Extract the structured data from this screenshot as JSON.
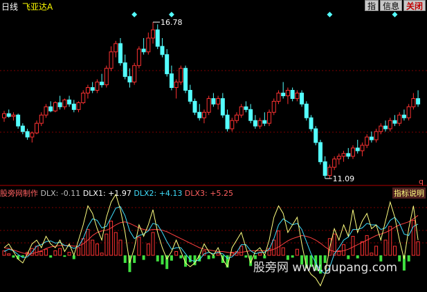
{
  "header": {
    "period": "日线",
    "stock_name": "飞亚达A",
    "buttons": [
      "指",
      "信息",
      "关闭"
    ]
  },
  "price_labels": {
    "high": "16.78",
    "low": "11.09"
  },
  "q_marker": "q",
  "indicator": {
    "name": "股旁网制作",
    "dlx": "DLX: -0.11",
    "dlx1": "DLX1: +1.97",
    "dlx2": "DLX2: +4.13",
    "dlx3": "DLX3: +5.25",
    "help": "指标说明"
  },
  "watermark": "股旁网 www.gupang.com",
  "colors": {
    "up": "#ff3232",
    "down": "#54ffff",
    "grid": "#800000",
    "dlx1": "#ffff80",
    "dlx2": "#40e0ff",
    "dlx3": "#ff4040"
  },
  "chart_data": {
    "type": "candlestick",
    "high_price": 16.78,
    "low_price": 11.09,
    "candles": [
      [
        13.3,
        13.55,
        13.15,
        13.45
      ],
      [
        13.45,
        13.6,
        13.3,
        13.35
      ],
      [
        13.35,
        13.5,
        13.2,
        13.4
      ],
      [
        13.4,
        13.45,
        12.9,
        13.0
      ],
      [
        13.0,
        13.1,
        12.7,
        12.8
      ],
      [
        12.8,
        12.9,
        12.5,
        12.6
      ],
      [
        12.6,
        12.8,
        12.4,
        12.75
      ],
      [
        12.75,
        13.2,
        12.7,
        13.1
      ],
      [
        13.1,
        13.5,
        13.0,
        13.4
      ],
      [
        13.4,
        13.8,
        13.3,
        13.7
      ],
      [
        13.7,
        13.9,
        13.5,
        13.55
      ],
      [
        13.55,
        13.9,
        13.5,
        13.85
      ],
      [
        13.85,
        14.1,
        13.6,
        13.7
      ],
      [
        13.7,
        14.0,
        13.6,
        13.95
      ],
      [
        13.95,
        14.1,
        13.7,
        13.8
      ],
      [
        13.8,
        13.95,
        13.5,
        13.6
      ],
      [
        13.6,
        13.9,
        13.5,
        13.85
      ],
      [
        13.85,
        14.3,
        13.8,
        14.2
      ],
      [
        14.2,
        14.5,
        14.0,
        14.4
      ],
      [
        14.4,
        14.6,
        14.2,
        14.3
      ],
      [
        14.3,
        14.7,
        14.2,
        14.6
      ],
      [
        14.6,
        14.9,
        14.4,
        14.5
      ],
      [
        14.5,
        15.2,
        14.4,
        15.1
      ],
      [
        15.1,
        15.9,
        15.0,
        15.7
      ],
      [
        15.7,
        16.1,
        15.5,
        16.0
      ],
      [
        16.0,
        16.2,
        15.2,
        15.3
      ],
      [
        15.3,
        15.6,
        14.7,
        14.8
      ],
      [
        14.8,
        15.1,
        14.4,
        14.6
      ],
      [
        14.6,
        15.3,
        14.5,
        15.2
      ],
      [
        15.2,
        15.9,
        15.1,
        15.8
      ],
      [
        15.8,
        16.2,
        15.6,
        15.7
      ],
      [
        15.7,
        16.4,
        15.6,
        16.2
      ],
      [
        16.2,
        16.78,
        16.0,
        16.5
      ],
      [
        16.5,
        16.7,
        15.8,
        15.9
      ],
      [
        15.9,
        16.2,
        15.5,
        15.6
      ],
      [
        15.6,
        15.8,
        14.8,
        14.9
      ],
      [
        14.9,
        15.2,
        14.3,
        14.4
      ],
      [
        14.4,
        14.7,
        14.0,
        14.6
      ],
      [
        14.6,
        15.2,
        14.5,
        15.1
      ],
      [
        15.1,
        15.2,
        14.2,
        14.3
      ],
      [
        14.3,
        14.5,
        13.8,
        13.9
      ],
      [
        13.9,
        14.0,
        13.4,
        13.5
      ],
      [
        13.5,
        13.8,
        13.2,
        13.3
      ],
      [
        13.3,
        13.6,
        13.1,
        13.5
      ],
      [
        13.5,
        14.1,
        13.4,
        14.0
      ],
      [
        14.0,
        14.2,
        13.7,
        13.8
      ],
      [
        13.8,
        14.1,
        13.6,
        14.0
      ],
      [
        14.0,
        14.2,
        13.3,
        13.4
      ],
      [
        13.4,
        13.6,
        12.8,
        12.9
      ],
      [
        12.9,
        13.3,
        12.8,
        13.2
      ],
      [
        13.2,
        13.5,
        13.1,
        13.4
      ],
      [
        13.4,
        13.8,
        13.3,
        13.7
      ],
      [
        13.7,
        13.9,
        13.5,
        13.6
      ],
      [
        13.6,
        13.8,
        13.1,
        13.2
      ],
      [
        13.2,
        13.4,
        12.9,
        13.0
      ],
      [
        13.0,
        13.3,
        12.9,
        13.2
      ],
      [
        13.2,
        13.5,
        13.0,
        13.1
      ],
      [
        13.1,
        13.6,
        13.0,
        13.5
      ],
      [
        13.5,
        14.0,
        13.4,
        13.9
      ],
      [
        13.9,
        14.3,
        13.8,
        14.2
      ],
      [
        14.2,
        14.6,
        14.0,
        14.1
      ],
      [
        14.1,
        14.4,
        13.8,
        14.3
      ],
      [
        14.3,
        14.4,
        13.9,
        14.0
      ],
      [
        14.0,
        14.3,
        13.9,
        14.2
      ],
      [
        14.2,
        14.3,
        13.7,
        13.8
      ],
      [
        13.8,
        13.9,
        13.2,
        13.3
      ],
      [
        13.3,
        13.4,
        12.8,
        12.9
      ],
      [
        12.9,
        13.0,
        12.3,
        12.4
      ],
      [
        12.4,
        12.5,
        11.6,
        11.7
      ],
      [
        11.7,
        11.9,
        11.09,
        11.2
      ],
      [
        11.2,
        11.6,
        11.1,
        11.5
      ],
      [
        11.5,
        11.9,
        11.4,
        11.8
      ],
      [
        11.8,
        12.0,
        11.6,
        11.9
      ],
      [
        11.9,
        12.1,
        11.7,
        12.0
      ],
      [
        12.0,
        12.2,
        11.8,
        11.9
      ],
      [
        11.9,
        12.3,
        11.8,
        12.2
      ],
      [
        12.2,
        12.5,
        12.0,
        12.1
      ],
      [
        12.1,
        12.4,
        11.9,
        12.3
      ],
      [
        12.3,
        12.7,
        12.2,
        12.6
      ],
      [
        12.6,
        12.8,
        12.4,
        12.5
      ],
      [
        12.5,
        12.9,
        12.4,
        12.8
      ],
      [
        12.8,
        13.1,
        12.7,
        13.0
      ],
      [
        13.0,
        13.2,
        12.8,
        12.9
      ],
      [
        12.9,
        13.3,
        12.8,
        13.2
      ],
      [
        13.2,
        13.4,
        13.0,
        13.1
      ],
      [
        13.1,
        13.5,
        13.0,
        13.4
      ],
      [
        13.4,
        13.6,
        13.2,
        13.3
      ],
      [
        13.3,
        13.8,
        13.2,
        13.7
      ],
      [
        13.7,
        14.2,
        13.6,
        14.0
      ],
      [
        14.0,
        14.3,
        13.7,
        13.8
      ]
    ],
    "dlx_bars": [
      0.6,
      0.2,
      -0.3,
      -0.5,
      -0.2,
      0.4,
      0.9,
      1.2,
      0.5,
      0.8,
      -0.3,
      0.6,
      0.9,
      -0.2,
      0.4,
      -0.5,
      1.0,
      2.2,
      3.4,
      2.0,
      1.5,
      0.3,
      2.8,
      4.5,
      3.0,
      2.0,
      -1.0,
      -2.2,
      -1.0,
      2.4,
      -0.6,
      1.5,
      3.0,
      -0.8,
      -1.2,
      -1.8,
      -0.7,
      0.5,
      -0.4,
      -1.5,
      -0.9,
      -1.3,
      -0.8,
      0.6,
      -0.5,
      -0.4,
      0.3,
      -1.0,
      -1.6,
      0.4,
      0.5,
      1.2,
      -0.3,
      -1.4,
      -0.5,
      0.3,
      -0.4,
      0.9,
      2.0,
      3.2,
      1.0,
      -0.6,
      -0.3,
      0.8,
      -1.2,
      -1.7,
      -1.5,
      -2.0,
      -2.4,
      -1.0,
      2.2,
      2.8,
      0.6,
      1.4,
      -0.5,
      2.5,
      -0.4,
      1.8,
      2.6,
      0.3,
      1.2,
      -0.8,
      2.0,
      3.8,
      1.2,
      -0.8,
      -2.0,
      -0.8,
      4.6,
      1.8
    ],
    "dlx1": [
      1.0,
      1.5,
      0.5,
      -0.5,
      -1.0,
      0.2,
      1.5,
      2.0,
      1.0,
      2.5,
      1.5,
      1.0,
      2.0,
      0.5,
      1.5,
      0.0,
      2.0,
      4.0,
      6.5,
      5.5,
      3.5,
      2.0,
      5.0,
      7.0,
      8.0,
      6.0,
      3.0,
      -1.0,
      1.0,
      4.0,
      2.5,
      4.0,
      6.0,
      3.0,
      1.0,
      -0.5,
      0.5,
      2.0,
      0.5,
      -1.0,
      -1.5,
      -1.0,
      0.0,
      1.5,
      0.5,
      0.0,
      1.0,
      -0.5,
      -1.5,
      1.0,
      2.0,
      3.0,
      1.0,
      -1.0,
      0.5,
      1.0,
      0.0,
      2.0,
      5.0,
      6.5,
      5.5,
      3.0,
      4.0,
      5.0,
      1.5,
      -1.5,
      -2.5,
      -3.0,
      -4.0,
      -2.5,
      1.0,
      3.5,
      2.0,
      4.0,
      2.5,
      6.0,
      3.0,
      4.5,
      5.5,
      3.5,
      4.0,
      2.0,
      4.5,
      7.0,
      5.0,
      2.0,
      -0.5,
      3.5,
      6.5,
      2.0
    ],
    "dlx2": [
      0.5,
      0.8,
      0.6,
      0.1,
      -0.3,
      -0.2,
      0.4,
      1.2,
      1.4,
      1.8,
      1.9,
      1.6,
      1.7,
      1.3,
      1.2,
      0.9,
      1.2,
      2.2,
      3.8,
      4.8,
      4.6,
      3.6,
      3.8,
      5.0,
      6.2,
      6.4,
      5.2,
      3.2,
      2.2,
      2.6,
      2.8,
      3.2,
      4.2,
      4.0,
      3.0,
      1.8,
      0.8,
      1.0,
      1.0,
      0.2,
      -0.6,
      -0.8,
      -0.6,
      0.2,
      0.4,
      0.2,
      0.4,
      0.2,
      -0.4,
      -0.2,
      0.4,
      1.4,
      1.4,
      0.6,
      0.2,
      0.4,
      0.4,
      0.8,
      2.2,
      4.0,
      4.8,
      4.4,
      4.0,
      4.2,
      3.4,
      1.8,
      0.2,
      -1.0,
      -2.0,
      -2.4,
      -1.6,
      0.2,
      1.0,
      2.0,
      2.4,
      3.4,
      3.4,
      3.6,
      4.2,
      4.0,
      4.0,
      3.4,
      3.6,
      4.6,
      5.0,
      4.2,
      2.8,
      2.6,
      3.8,
      4.1
    ],
    "dlx3": [
      1.0,
      0.9,
      0.7,
      0.5,
      0.3,
      0.2,
      0.2,
      0.4,
      0.6,
      0.9,
      1.1,
      1.2,
      1.3,
      1.3,
      1.3,
      1.2,
      1.2,
      1.5,
      2.0,
      2.6,
      3.0,
      3.2,
      3.3,
      3.6,
      4.0,
      4.3,
      4.4,
      4.2,
      3.9,
      3.6,
      3.4,
      3.3,
      3.4,
      3.4,
      3.3,
      3.1,
      2.8,
      2.5,
      2.2,
      1.9,
      1.6,
      1.3,
      1.0,
      0.8,
      0.7,
      0.6,
      0.5,
      0.5,
      0.4,
      0.3,
      0.3,
      0.4,
      0.5,
      0.6,
      0.6,
      0.6,
      0.6,
      0.6,
      0.8,
      1.1,
      1.5,
      1.9,
      2.2,
      2.4,
      2.6,
      2.5,
      2.3,
      2.0,
      1.6,
      1.1,
      0.7,
      0.5,
      0.5,
      0.6,
      0.8,
      1.1,
      1.4,
      1.7,
      2.0,
      2.3,
      2.6,
      2.8,
      3.0,
      3.3,
      3.7,
      4.0,
      4.2,
      4.4,
      4.8,
      5.25
    ],
    "diamond_candles": [
      28,
      36,
      70,
      84
    ]
  }
}
